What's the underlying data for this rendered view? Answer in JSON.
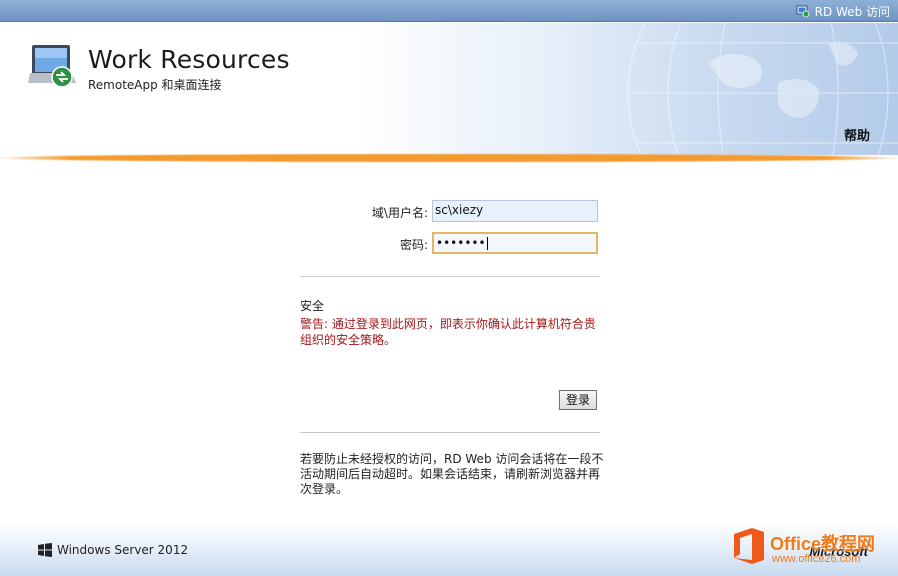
{
  "topbar": {
    "title": "RD Web 访问",
    "icon": "rd-web-icon"
  },
  "header": {
    "title": "Work Resources",
    "subtitle": "RemoteApp 和桌面连接",
    "help_label": "帮助",
    "logo_icon": "remote-desktop-icon"
  },
  "colors": {
    "accent_orange": "#f39b2f",
    "warning_red": "#a4161a",
    "topbar_blue": "#7fa2cf"
  },
  "login": {
    "username_label": "域\\用户名:",
    "username_value": "sc\\xiezy",
    "password_label": "密码:",
    "password_value": "•••••••"
  },
  "security": {
    "title": "安全",
    "warning": "警告: 通过登录到此网页，即表示你确认此计算机符合贵组织的安全策略。"
  },
  "buttons": {
    "signin_label": "登录"
  },
  "notice": {
    "text": "若要防止未经授权的访问，RD Web 访问会话将在一段不活动期间后自动超时。如果会话结束，请刷新浏览器并再次登录。"
  },
  "footer": {
    "product": "Windows Server 2012",
    "brand": "Microsoft"
  },
  "watermark": {
    "title": "Office教程网",
    "url": "www.office26.com"
  }
}
